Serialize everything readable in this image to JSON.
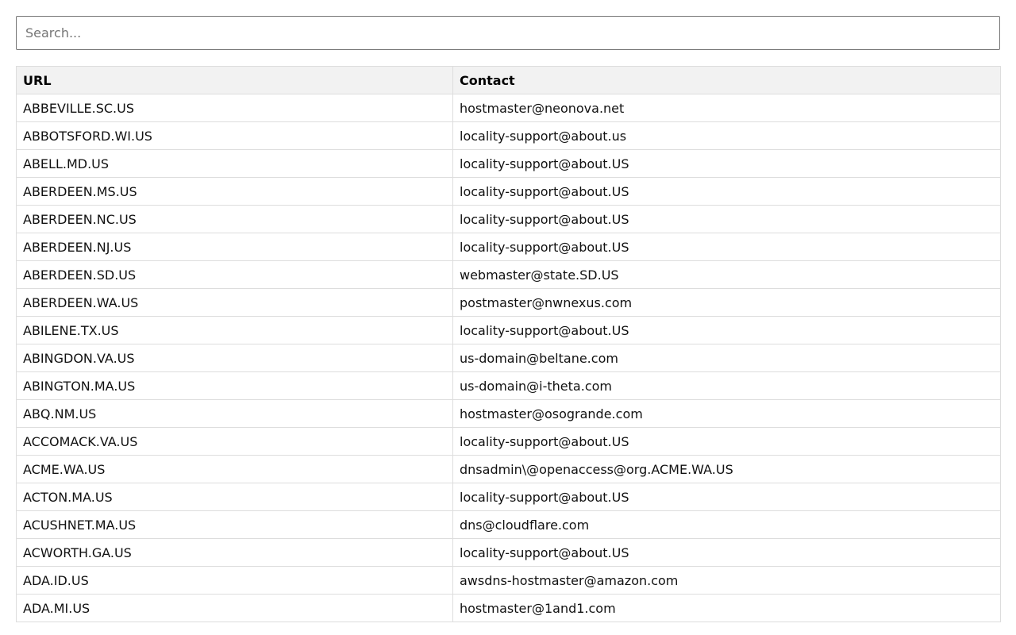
{
  "search": {
    "placeholder": "Search...",
    "value": ""
  },
  "table": {
    "headers": [
      "URL",
      "Contact"
    ],
    "rows": [
      [
        "ABBEVILLE.SC.US",
        "hostmaster@neonova.net"
      ],
      [
        "ABBOTSFORD.WI.US",
        "locality-support@about.us"
      ],
      [
        "ABELL.MD.US",
        "locality-support@about.US"
      ],
      [
        "ABERDEEN.MS.US",
        "locality-support@about.US"
      ],
      [
        "ABERDEEN.NC.US",
        "locality-support@about.US"
      ],
      [
        "ABERDEEN.NJ.US",
        "locality-support@about.US"
      ],
      [
        "ABERDEEN.SD.US",
        "webmaster@state.SD.US"
      ],
      [
        "ABERDEEN.WA.US",
        "postmaster@nwnexus.com"
      ],
      [
        "ABILENE.TX.US",
        "locality-support@about.US"
      ],
      [
        "ABINGDON.VA.US",
        "us-domain@beltane.com"
      ],
      [
        "ABINGTON.MA.US",
        "us-domain@i-theta.com"
      ],
      [
        "ABQ.NM.US",
        "hostmaster@osogrande.com"
      ],
      [
        "ACCOMACK.VA.US",
        "locality-support@about.US"
      ],
      [
        "ACME.WA.US",
        "dnsadmin\\@openaccess@org.ACME.WA.US"
      ],
      [
        "ACTON.MA.US",
        "locality-support@about.US"
      ],
      [
        "ACUSHNET.MA.US",
        "dns@cloudflare.com"
      ],
      [
        "ACWORTH.GA.US",
        "locality-support@about.US"
      ],
      [
        "ADA.ID.US",
        "awsdns-hostmaster@amazon.com"
      ],
      [
        "ADA.MI.US",
        "hostmaster@1and1.com"
      ]
    ]
  }
}
